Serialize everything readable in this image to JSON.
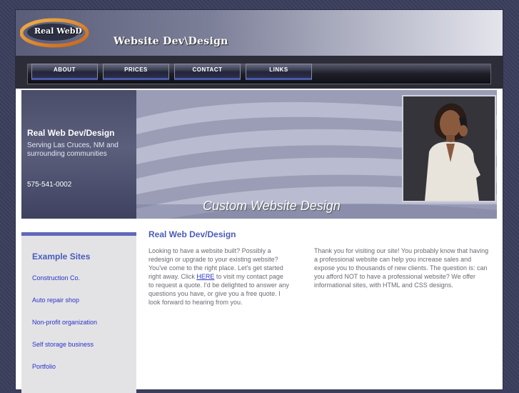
{
  "header": {
    "logo_text": "Real WebD",
    "title": "Website Dev\\Design"
  },
  "nav": {
    "items": [
      {
        "label": "ABOUT"
      },
      {
        "label": "PRICES"
      },
      {
        "label": "CONTACT"
      },
      {
        "label": "LINKS"
      }
    ]
  },
  "banner": {
    "name": "Real Web Dev/Design",
    "tagline": "Serving Las Cruces, NM and surrounding communities",
    "phone": "575-541-0002",
    "caption": "Custom Website Design"
  },
  "sidebar": {
    "title": "Example Sites",
    "links": [
      {
        "label": "Construction Co."
      },
      {
        "label": "Auto repair shop"
      },
      {
        "label": "Non-profit organization"
      },
      {
        "label": "Self storage business"
      },
      {
        "label": "Portfolio"
      }
    ]
  },
  "main": {
    "heading": "Real Web Dev/Design",
    "col1_before": "Looking to have a website built? Possibly a redesign or upgrade to your existing website? You've come to the right place. Let's get started right away. Click ",
    "col1_link": "HERE",
    "col1_after": " to visit my contact page to request a quote. I'd be delighted to answer any questions you have, or give you a free quote. I look forward to hearing from you.",
    "col2": "Thank you for visiting our site! You probably know that having a professional website can help you increase sales and expose you to thousands of new clients. The question is: can you afford NOT to have a professional website? We offer informational sites, with HTML and CSS designs."
  },
  "colors": {
    "accent": "#4a5cb8",
    "link": "#2a32c6",
    "page_bg": "#3b3e5c"
  }
}
